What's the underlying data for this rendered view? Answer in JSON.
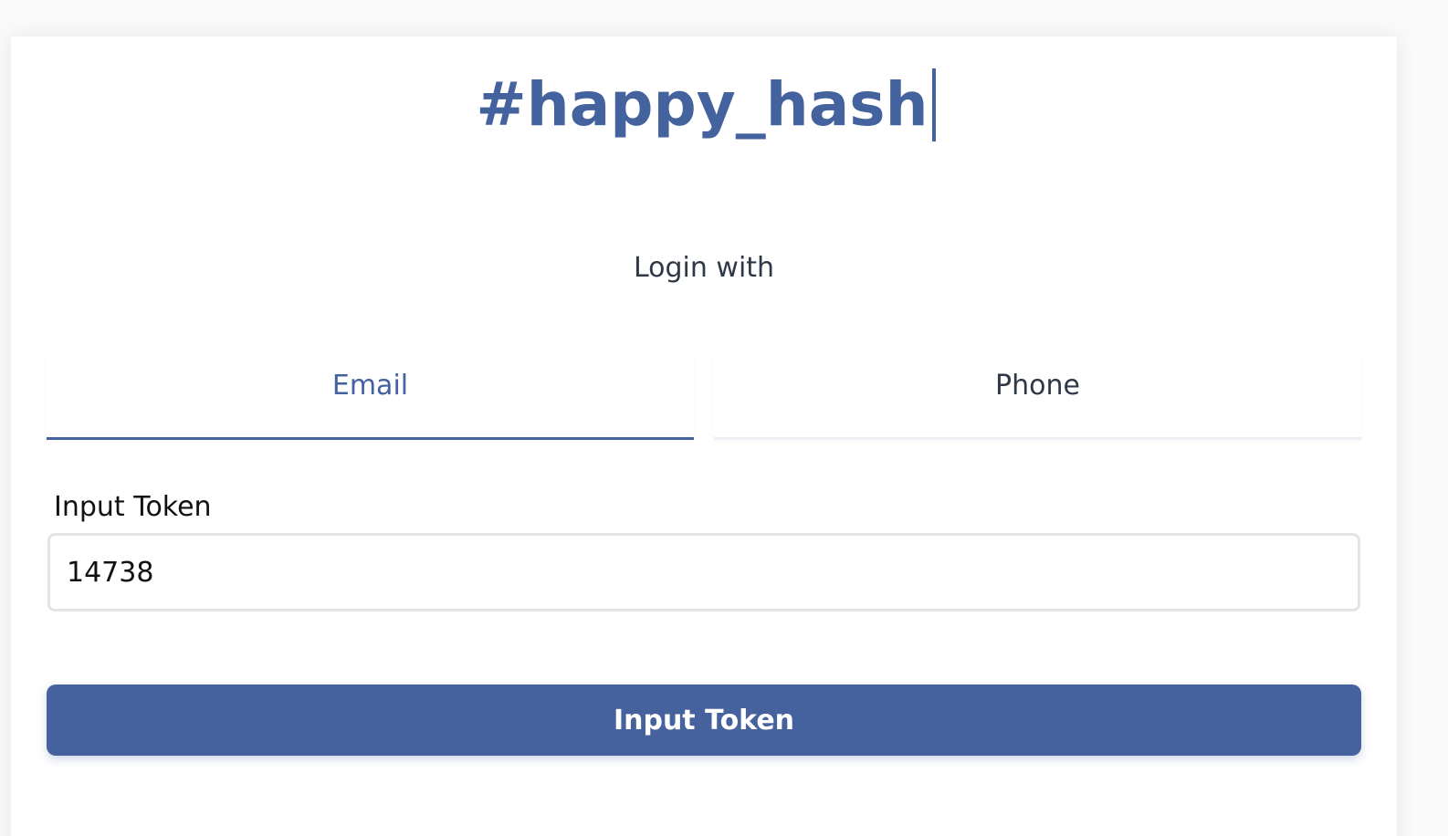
{
  "brand": {
    "title": "#happy_hash",
    "color": "#44629e"
  },
  "login": {
    "prompt": "Login with"
  },
  "tabs": [
    {
      "label": "Email",
      "active": true
    },
    {
      "label": "Phone",
      "active": false
    }
  ],
  "token_field": {
    "label": "Input Token",
    "value": "14738"
  },
  "submit": {
    "label": "Input Token",
    "color": "#45629e"
  }
}
